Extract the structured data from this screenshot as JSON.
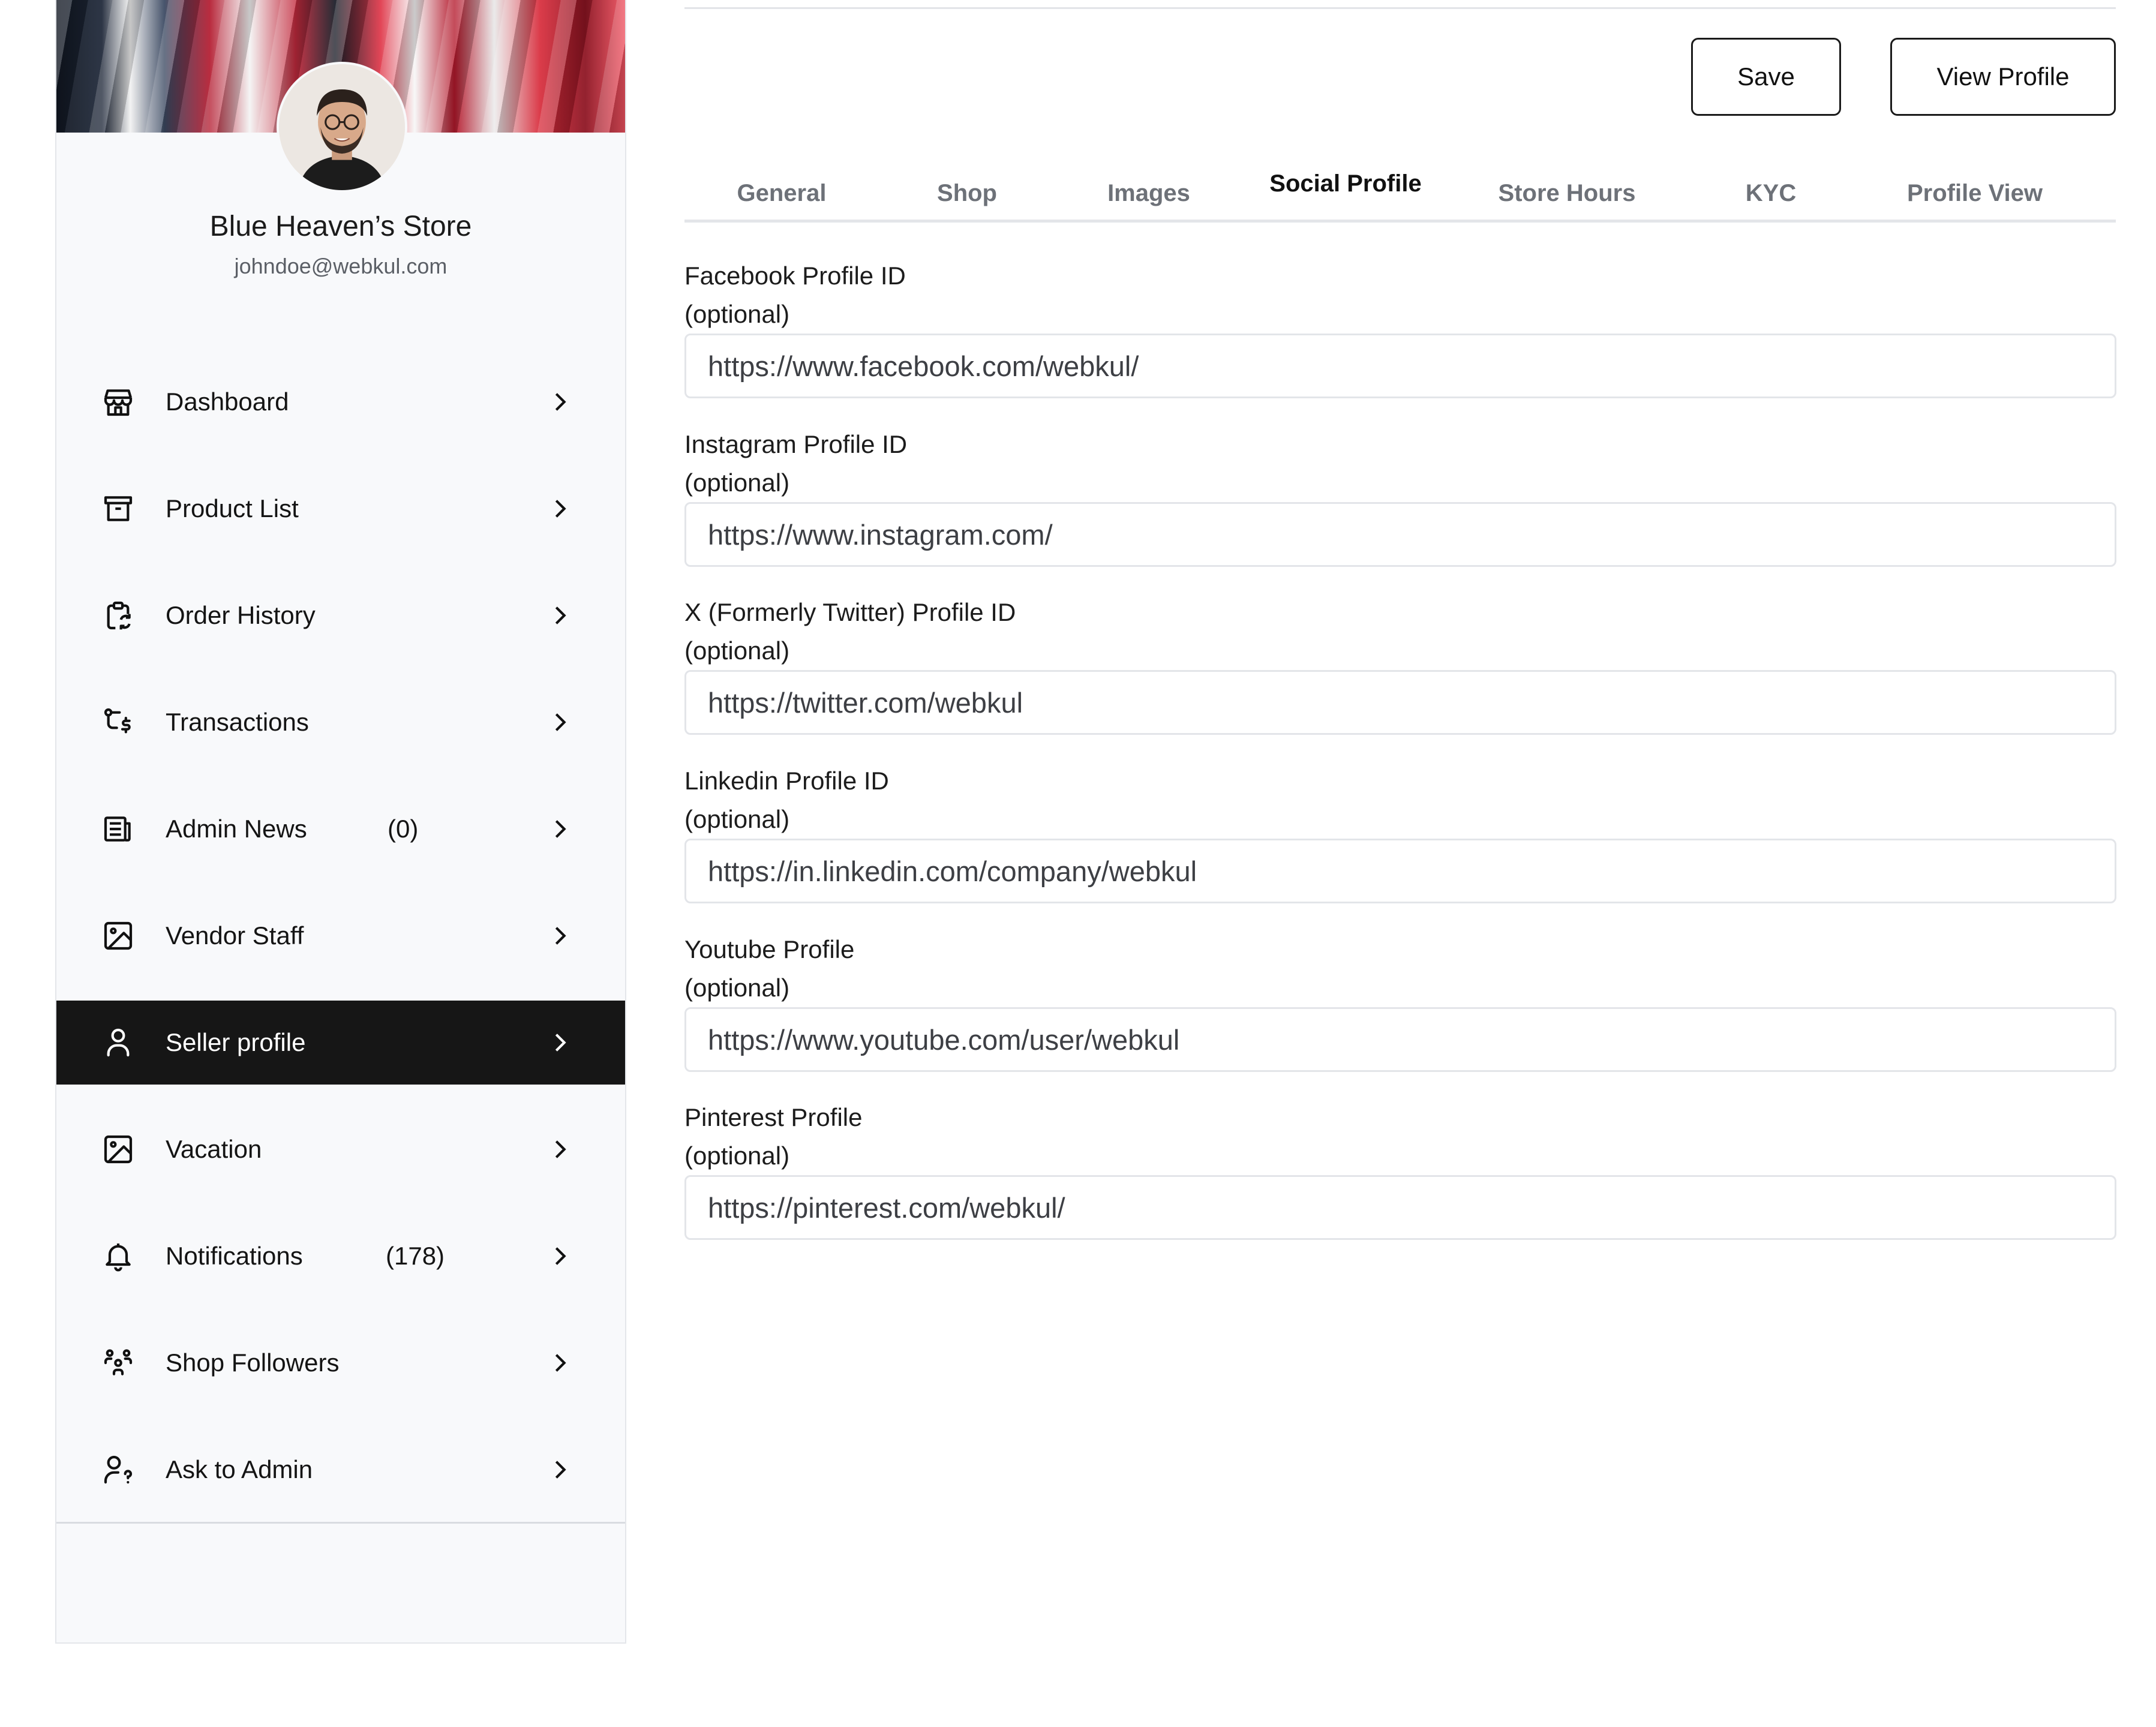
{
  "profile": {
    "store_name": "Blue Heaven’s Store",
    "email": "johndoe@webkul.com"
  },
  "nav": {
    "items": [
      {
        "label": "Dashboard",
        "icon": "store-icon",
        "count": ""
      },
      {
        "label": "Product List",
        "icon": "archive-icon",
        "count": ""
      },
      {
        "label": "Order History",
        "icon": "clipboard-refresh-icon",
        "count": ""
      },
      {
        "label": "Transactions",
        "icon": "route-dollar-icon",
        "count": ""
      },
      {
        "label": "Admin News",
        "icon": "news-icon",
        "count": "(0)"
      },
      {
        "label": "Vendor Staff",
        "icon": "image-icon",
        "count": ""
      },
      {
        "label": "Seller profile",
        "icon": "user-icon",
        "count": "",
        "active": true
      },
      {
        "label": "Vacation",
        "icon": "image-icon",
        "count": ""
      },
      {
        "label": "Notifications",
        "icon": "bell-icon",
        "count": "(178)"
      },
      {
        "label": "Shop Followers",
        "icon": "users-group-icon",
        "count": ""
      },
      {
        "label": "Ask to Admin",
        "icon": "user-question-icon",
        "count": ""
      }
    ]
  },
  "toolbar": {
    "save_label": "Save",
    "view_profile_label": "View Profile"
  },
  "tabs": [
    {
      "label": "General"
    },
    {
      "label": "Shop"
    },
    {
      "label": "Images"
    },
    {
      "label": "Social Profile",
      "active": true
    },
    {
      "label": "Store Hours"
    },
    {
      "label": "KYC"
    },
    {
      "label": "Profile View"
    }
  ],
  "form": {
    "optional_text": "(optional)",
    "fields": [
      {
        "label": "Facebook Profile ID",
        "value": "https://www.facebook.com/webkul/"
      },
      {
        "label": "Instagram Profile ID",
        "value": "https://www.instagram.com/"
      },
      {
        "label": "X (Formerly Twitter) Profile ID",
        "value": "https://twitter.com/webkul"
      },
      {
        "label": "Linkedin Profile ID",
        "value": "https://in.linkedin.com/company/webkul"
      },
      {
        "label": "Youtube Profile",
        "value": "https://www.youtube.com/user/webkul"
      },
      {
        "label": "Pinterest Profile",
        "value": "https://pinterest.com/webkul/"
      }
    ]
  }
}
